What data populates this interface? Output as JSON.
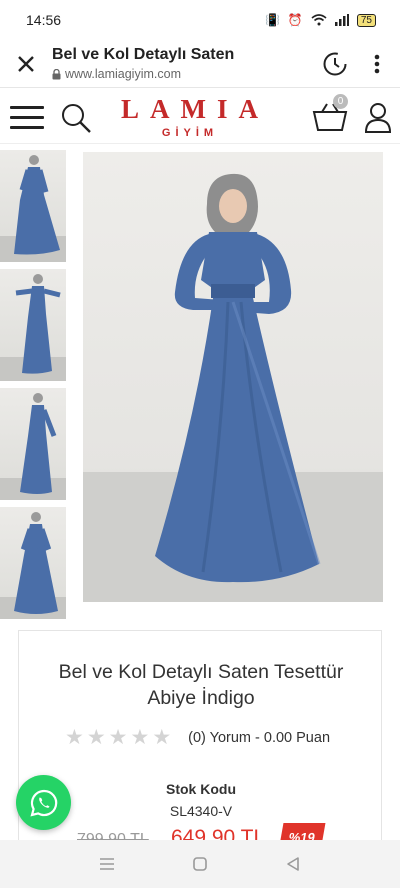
{
  "status": {
    "time": "14:56",
    "battery": "75"
  },
  "tab": {
    "title": "Bel ve Kol Detaylı Saten",
    "url": "www.lamiagiyim.com"
  },
  "site": {
    "logo_main": "LAMIA",
    "logo_sub": "GİYİM",
    "cart_count": "0"
  },
  "product": {
    "name": "Bel ve Kol Detaylı Saten Tesettür Abiye İndigo",
    "rating_text": "(0) Yorum - 0.00 Puan",
    "rating_stars": 0,
    "stock_label": "Stok Kodu",
    "stock_code": "SL4340-V",
    "old_price": "799,90 TL",
    "new_price": "649,90 TL",
    "discount": "%19"
  },
  "colors": {
    "brand": "#c42a2a",
    "dress": "#4a6ea8",
    "price": "#e0342a",
    "whatsapp": "#25d366"
  },
  "icons": [
    "close-icon",
    "lock-icon",
    "history-icon",
    "more-vert-icon",
    "menu-icon",
    "search-icon",
    "cart-icon",
    "user-icon",
    "star-icon",
    "whatsapp-icon",
    "nav-menu-icon",
    "nav-home-icon",
    "nav-back-icon"
  ]
}
